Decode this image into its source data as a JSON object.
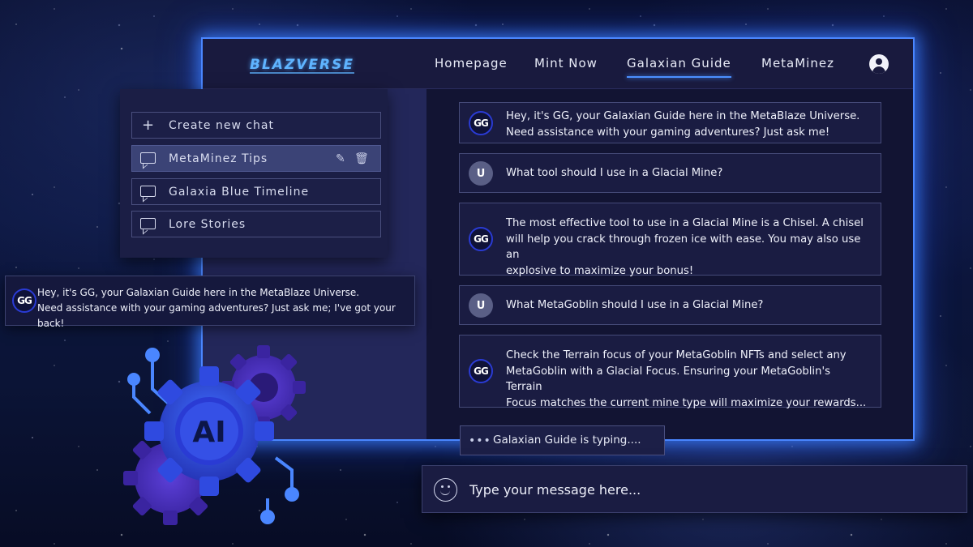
{
  "brand": {
    "logo_text": "BLAZVERSE"
  },
  "nav": {
    "items": [
      {
        "label": "Homepage",
        "active": false
      },
      {
        "label": "Mint Now",
        "active": false
      },
      {
        "label": "Galaxian Guide",
        "active": true
      },
      {
        "label": "MetaMinez",
        "active": false
      }
    ],
    "user_icon": "user-icon"
  },
  "sidebar": {
    "new_chat_label": "Create new chat",
    "items": [
      {
        "label": "MetaMinez Tips",
        "active": true
      },
      {
        "label": "Galaxia Blue Timeline",
        "active": false
      },
      {
        "label": "Lore Stories",
        "active": false
      }
    ]
  },
  "floating_card": {
    "avatar": "GG",
    "line1": "Hey, it's GG, your Galaxian Guide here in the MetaBlaze Universe.",
    "line2": "Need assistance with your gaming adventures? Just ask me; I've got your back!"
  },
  "messages": [
    {
      "sender": "GG",
      "lines": [
        "Hey, it's GG, your Galaxian Guide here in the MetaBlaze Universe.",
        "Need assistance with your gaming adventures? Just ask me!"
      ]
    },
    {
      "sender": "U",
      "lines": [
        "What tool should I use in a Glacial Mine?"
      ]
    },
    {
      "sender": "GG",
      "lines": [
        "The most effective tool to use in a Glacial Mine is a Chisel. A chisel",
        "will help you crack through frozen ice with ease. You may also use an",
        "explosive to maximize your bonus!"
      ]
    },
    {
      "sender": "U",
      "lines": [
        "What MetaGoblin should I use in a Glacial Mine?"
      ]
    },
    {
      "sender": "GG",
      "lines": [
        "Check the Terrain focus of your MetaGoblin NFTs and select any",
        "MetaGoblin with a Glacial Focus. Ensuring your MetaGoblin's Terrain",
        "Focus matches the current mine type will maximize your rewards..."
      ]
    }
  ],
  "typing": {
    "label": "Galaxian Guide is typing...."
  },
  "composer": {
    "placeholder": "Type your message here..."
  },
  "graphic": {
    "label": "AI"
  },
  "colors": {
    "accent": "#4a86ff",
    "panel": "#1a1c42",
    "background": "#0c163f"
  }
}
